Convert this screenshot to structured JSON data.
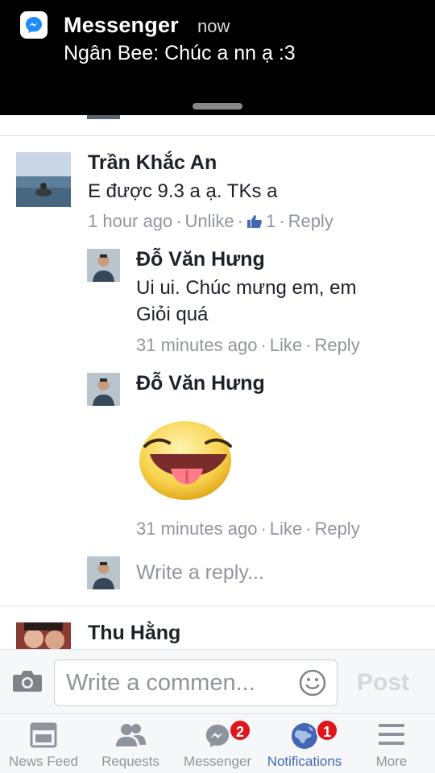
{
  "notification": {
    "app_name": "Messenger",
    "time": "now",
    "message": "Ngân Bee: Chúc a nn ạ :3"
  },
  "comments": [
    {
      "author": "Trần Khắc An",
      "text": "E được 9.3 a ạ.  TKs a",
      "time": "1 hour ago",
      "action": "Unlike",
      "like_count": "1",
      "reply": "Reply"
    }
  ],
  "replies": [
    {
      "author": "Đỗ Văn Hưng",
      "text_line1": "Ui ui. Chúc mưng em, em",
      "text_line2": "Giỏi quá",
      "time": "31 minutes ago",
      "action": "Like",
      "reply": "Reply"
    },
    {
      "author": "Đỗ Văn Hưng",
      "sticker": "tongue-out-emoji",
      "time": "31 minutes ago",
      "action": "Like",
      "reply": "Reply"
    }
  ],
  "reply_input": {
    "placeholder": "Write a reply..."
  },
  "next_comment": {
    "author": "Thu Hằng"
  },
  "comment_bar": {
    "placeholder": "Write a commen...",
    "post_label": "Post"
  },
  "tabs": [
    {
      "label": "News Feed",
      "icon": "news-feed-icon"
    },
    {
      "label": "Requests",
      "icon": "friend-requests-icon"
    },
    {
      "label": "Messenger",
      "icon": "messenger-icon",
      "badge": "2"
    },
    {
      "label": "Notifications",
      "icon": "globe-icon",
      "badge": "1",
      "active": true
    },
    {
      "label": "More",
      "icon": "menu-icon"
    }
  ],
  "colors": {
    "accent": "#4267b2",
    "badge": "#e0151a",
    "secondary_text": "#90949c"
  }
}
